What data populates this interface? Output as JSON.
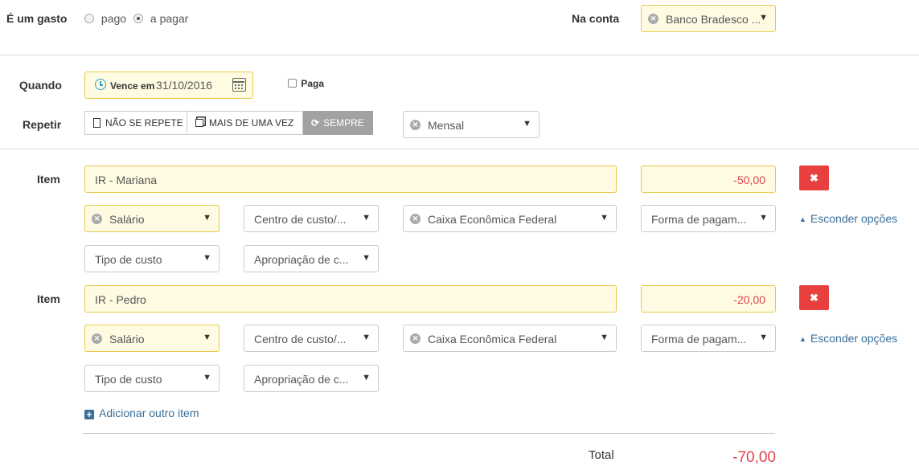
{
  "expense": {
    "label": "É um gasto",
    "options": [
      "pago",
      "a pagar"
    ],
    "selected": "a pagar"
  },
  "account": {
    "label": "Na conta",
    "value": "Banco Bradesco ..."
  },
  "when": {
    "label": "Quando",
    "due_prefix": "Vence em",
    "due_date": "31/10/2016",
    "paid_label": "Paga",
    "paid_checked": false
  },
  "repeat": {
    "label": "Repetir",
    "options": [
      "NÃO SE REPETE",
      "MAIS DE UMA VEZ",
      "SEMPRE"
    ],
    "active": "SEMPRE",
    "frequency": "Mensal"
  },
  "items": [
    {
      "label": "Item",
      "description": "IR - Mariana",
      "amount": "-50,00",
      "category": "Salário",
      "cost_center_placeholder": "Centro de custo/...",
      "account": "Caixa Econômica Federal",
      "payment_placeholder": "Forma de pagam...",
      "cost_type_placeholder": "Tipo de custo",
      "appropriation_placeholder": "Apropriação de c...",
      "toggle_options": "Esconder opções"
    },
    {
      "label": "Item",
      "description": "IR - Pedro",
      "amount": "-20,00",
      "category": "Salário",
      "cost_center_placeholder": "Centro de custo/...",
      "account": "Caixa Econômica Federal",
      "payment_placeholder": "Forma de pagam...",
      "cost_type_placeholder": "Tipo de custo",
      "appropriation_placeholder": "Apropriação de c...",
      "toggle_options": "Esconder opções"
    }
  ],
  "add_item": "Adicionar outro item",
  "total": {
    "label": "Total",
    "value": "-70,00"
  },
  "colors": {
    "highlight_border": "#e8c94a",
    "highlight_bg": "#fffbe3",
    "negative": "#e0434d",
    "delete": "#e8403e",
    "link": "#3a6f9a"
  }
}
